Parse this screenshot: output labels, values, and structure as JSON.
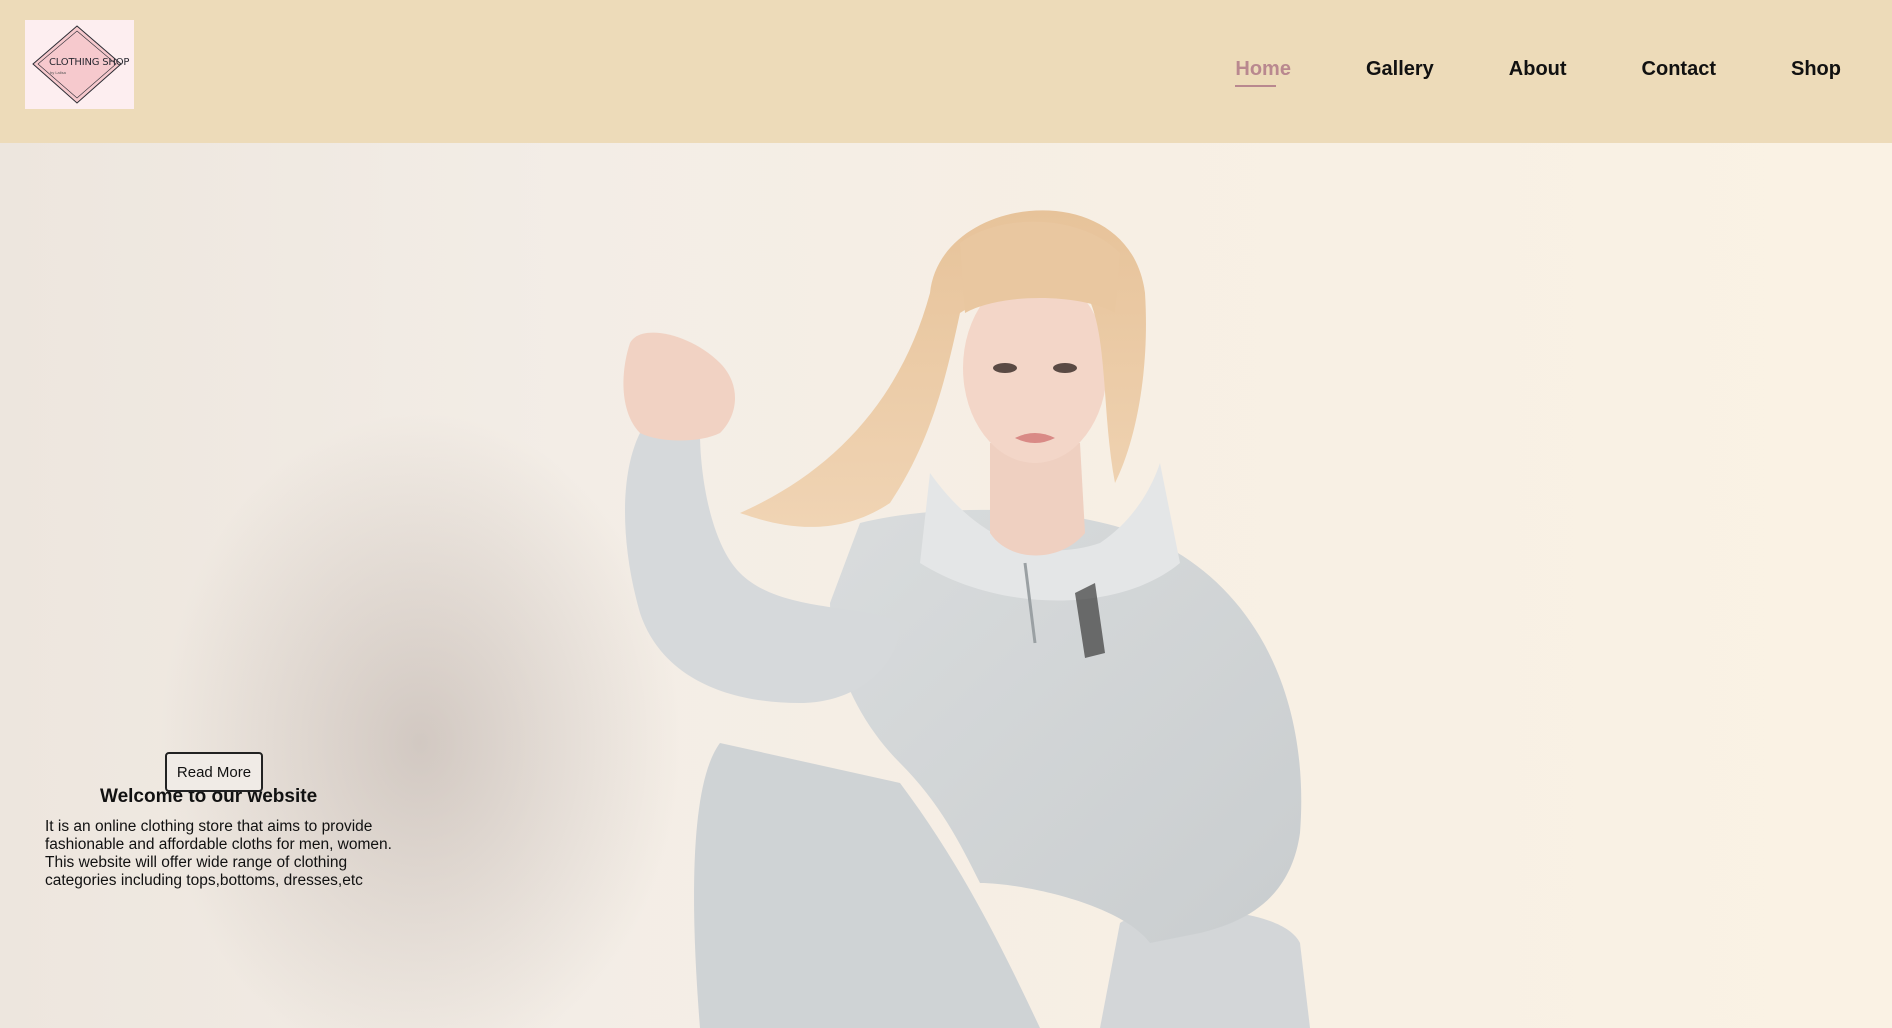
{
  "logo": {
    "brand": "CLOTHING SHOP",
    "tagline": "by Lalisa"
  },
  "nav": {
    "items": [
      {
        "label": "Home",
        "active": true
      },
      {
        "label": "Gallery",
        "active": false
      },
      {
        "label": "About",
        "active": false
      },
      {
        "label": "Contact",
        "active": false
      },
      {
        "label": "Shop",
        "active": false
      }
    ]
  },
  "hero": {
    "image": "model-in-grey-sweatsuit",
    "title": "Welcome to our website",
    "description": "It is an online clothing store that aims to provide fashionable and affordable cloths for men, women. This website will offer wide range of clothing categories including tops,bottoms, dresses,etc",
    "button_label": "Read More"
  },
  "colors": {
    "header_bg": "#eddbb9",
    "active_nav": "#b9888f",
    "hero_bg": "#f5eee5"
  }
}
